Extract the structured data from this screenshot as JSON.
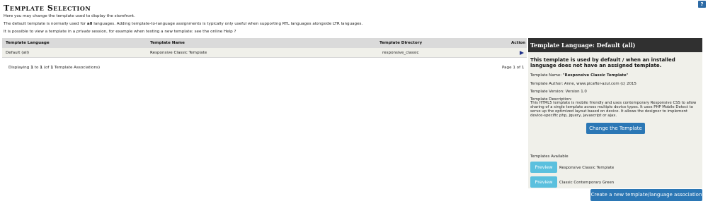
{
  "page": {
    "title": "Template Selection",
    "help_label": "?",
    "intro": {
      "line1": "Here you may change the template used to display the storefront.",
      "line2_pre": "The default template is normally used for ",
      "line2_bold": "all",
      "line2_post": " languages. Adding template-to-language assignments is typically only useful when supporting RTL languages alongside LTR languages.",
      "line3_pre": "It is possible to view a template in a ",
      "line3_italic": "private",
      "line3_post": " session, for example when testing a new template: see the online Help ?"
    }
  },
  "table": {
    "columns": [
      "Template Language",
      "Template Name",
      "Template Directory",
      "Action"
    ],
    "rows": [
      {
        "language": "Default (all)",
        "name": "Responsive Classic Template",
        "directory": "responsive_classic"
      }
    ],
    "footer_pre": "Displaying ",
    "footer_from": "1",
    "footer_mid1": " to ",
    "footer_to": "1",
    "footer_mid2": " (of ",
    "footer_total": "1",
    "footer_post": " Template Associations)",
    "page_info": "Page 1 of 1"
  },
  "panel": {
    "header": "Template Language: Default (all)",
    "headline": "This template is used by default / when an installed language does not have an assigned template.",
    "name_label": "Template Name: ",
    "name_value": "\"Responsive Classic Template\"",
    "author": "Template Author: Anne, www.picaflor-azul.com (c) 2015",
    "version": "Template Version: Version 1.0",
    "description_label": "Template Description:",
    "description": "This HTML5 template is mobile friendly and uses contemporary Responsive CSS to allow sharing of a single template across multiple device types. It uses PHP Mobile Detect to serve up the optimized layout based on device. It allows the designer to implement device-specific php, jquery, javascript or ajax.",
    "change_button": "Change the Template",
    "available_label": "Templates Available",
    "templates": [
      {
        "preview": "Preview",
        "name": "Responsive Classic Template"
      },
      {
        "preview": "Preview",
        "name": "Classic Contemporary Green"
      }
    ]
  },
  "create_button": "Create a new template/language association",
  "colors": {
    "panel_header_bg": "#303030",
    "primary_button": "#2b77b5",
    "preview_button": "#5bc0de",
    "action_arrow": "#1e2f8a"
  }
}
